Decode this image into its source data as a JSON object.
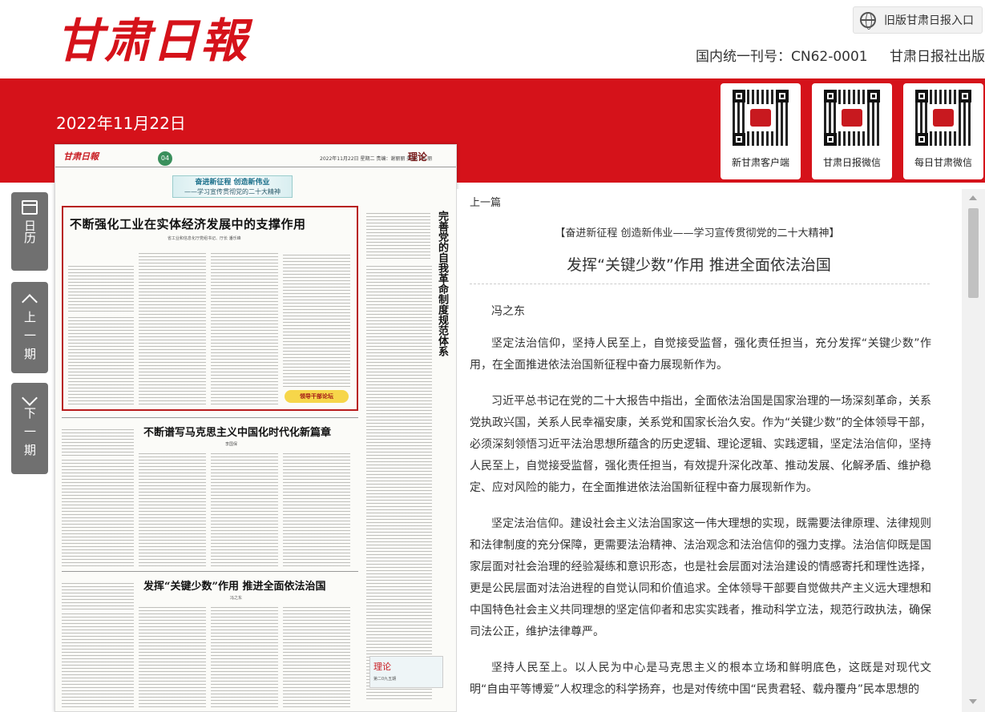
{
  "header": {
    "logo_text": "甘肃日報",
    "old_version_label": "旧版甘肃日报入口",
    "issn": "国内统一刊号：CN62-0001",
    "publisher": "甘肃日报社出版"
  },
  "date": "2022年11月22日",
  "qr_codes": [
    {
      "label": "新甘肃客户端"
    },
    {
      "label": "甘肃日报微信"
    },
    {
      "label": "每日甘肃微信"
    }
  ],
  "nav": {
    "calendar": "日历",
    "prev_issue": "上一期",
    "next_issue": "下一期"
  },
  "newspaper_page": {
    "logo": "甘肃日報",
    "page_number": "04",
    "meta": "2022年11月22日  星期二  责编：谢丽丽  美编：陈 丽",
    "section": "理论",
    "banner_main": "奋进新征程 创造新伟业",
    "banner_sub": "——学习宣传贯彻党的二十大精神",
    "article1_title": "不断强化工业在实体经济发展中的支撑作用",
    "article1_author": "省工业和信息化厅党组书记、厅长  潘乐峰",
    "side_title": "完善党的自我革命制度规范体系",
    "stamp": "领导干部论坛",
    "article2_title": "不断谱写马克思主义中国化时代化新篇章",
    "article2_author": "李国保",
    "article3_title": "发挥“关键少数”作用  推进全面依法治国",
    "article3_author": "冯之东",
    "promo_title": "理论",
    "promo_sub": "第二0九五期"
  },
  "article": {
    "prev_link": "上一篇",
    "column": "【奋进新征程 创造新伟业——学习宣传贯彻党的二十大精神】",
    "headline": "发挥“关键少数”作用 推进全面依法治国",
    "author": "冯之东",
    "paragraphs": [
      "坚定法治信仰，坚持人民至上，自觉接受监督，强化责任担当，充分发挥“关键少数”作用，在全面推进依法治国新征程中奋力展现新作为。",
      "习近平总书记在党的二十大报告中指出，全面依法治国是国家治理的一场深刻革命，关系党执政兴国，关系人民幸福安康，关系党和国家长治久安。作为“关键少数”的全体领导干部，必须深刻领悟习近平法治思想所蕴含的历史逻辑、理论逻辑、实践逻辑，坚定法治信仰，坚持人民至上，自觉接受监督，强化责任担当，有效提升深化改革、推动发展、化解矛盾、维护稳定、应对风险的能力，在全面推进依法治国新征程中奋力展现新作为。",
      "坚定法治信仰。建设社会主义法治国家这一伟大理想的实现，既需要法律原理、法律规则和法律制度的充分保障，更需要法治精神、法治观念和法治信仰的强力支撑。法治信仰既是国家层面对社会治理的经验凝练和意识形态，也是社会层面对法治建设的情感寄托和理性选择，更是公民层面对法治进程的自觉认同和价值追求。全体领导干部要自觉做共产主义远大理想和中国特色社会主义共同理想的坚定信仰者和忠实实践者，推动科学立法，规范行政执法，确保司法公正，维护法律尊严。",
      "坚持人民至上。以人民为中心是马克思主义的根本立场和鲜明底色，这既是对现代文明“自由平等博爱”人权理念的科学扬弃，也是对传统中国“民贵君轻、载舟覆舟”民本思想的"
    ]
  },
  "colors": {
    "brand_red": "#d5121a",
    "nav_gray": "#707070"
  }
}
